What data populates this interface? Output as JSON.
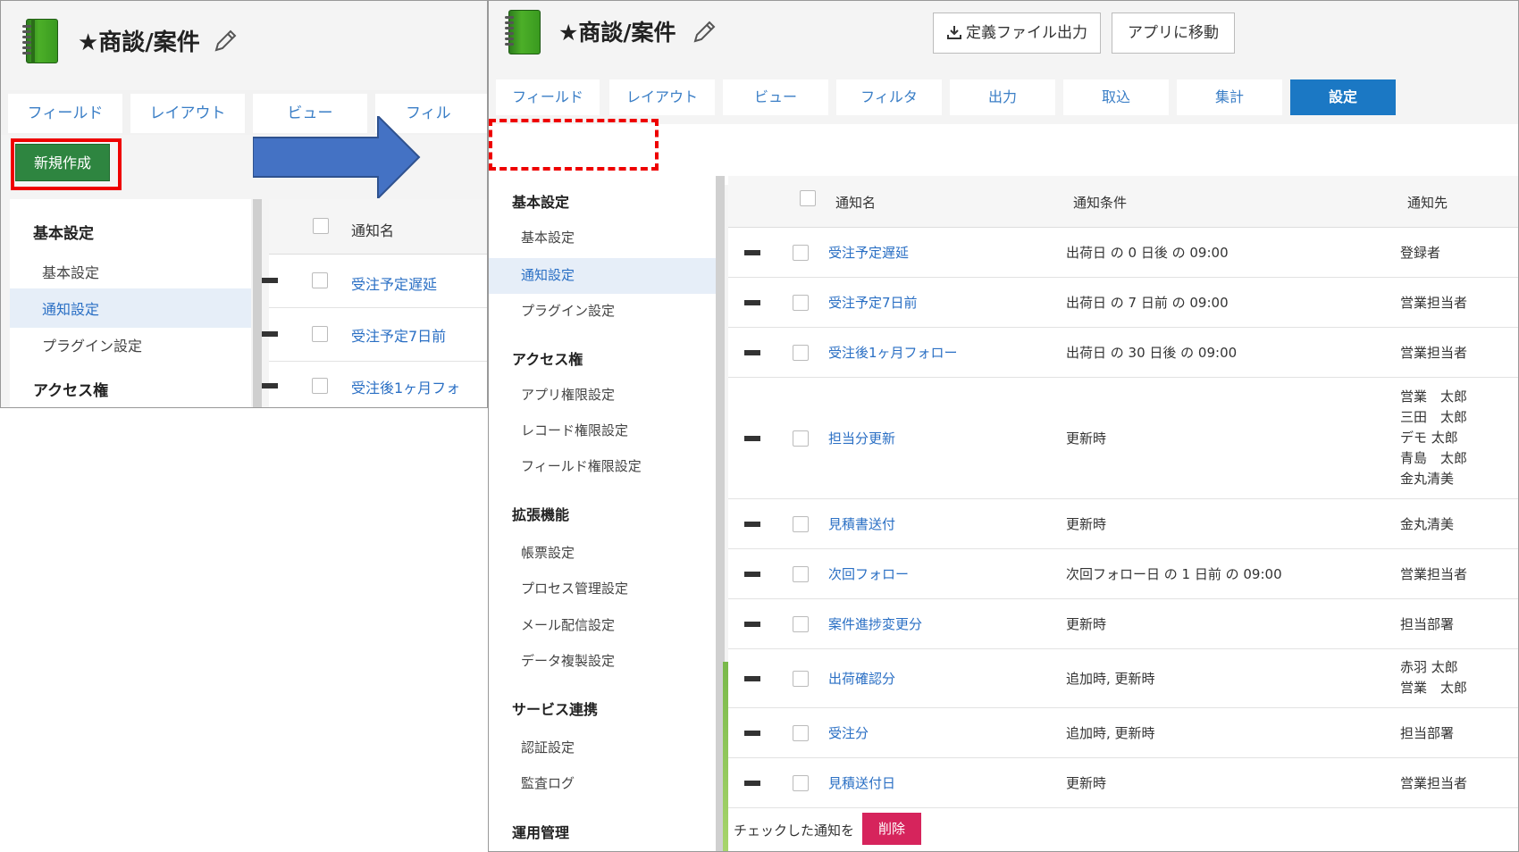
{
  "app": {
    "title": "★商談/案件"
  },
  "left_panel": {
    "tabs": [
      "フィールド",
      "レイアウト",
      "ビュー",
      "フィル"
    ],
    "new_button": "新規作成",
    "menu": {
      "section_basic": "基本設定",
      "items": [
        "基本設定",
        "通知設定",
        "プラグイン設定"
      ],
      "section_access": "アクセス権"
    },
    "table": {
      "header_name": "通知名",
      "rows": [
        "受注予定遅延",
        "受注予定7日前",
        "受注後1ヶ月フォ"
      ]
    }
  },
  "right_panel": {
    "buttons": {
      "export": "定義ファイル出力",
      "goto_app": "アプリに移動"
    },
    "tabs": [
      "フィールド",
      "レイアウト",
      "ビュー",
      "フィルタ",
      "出力",
      "取込",
      "集計",
      "設定"
    ],
    "active_tab": "設定",
    "menu": [
      {
        "heading": "基本設定",
        "items": [
          "基本設定",
          "通知設定",
          "プラグイン設定"
        ]
      },
      {
        "heading": "アクセス権",
        "items": [
          "アプリ権限設定",
          "レコード権限設定",
          "フィールド権限設定"
        ]
      },
      {
        "heading": "拡張機能",
        "items": [
          "帳票設定",
          "プロセス管理設定",
          "メール配信設定",
          "データ複製設定"
        ]
      },
      {
        "heading": "サービス連携",
        "items": [
          "認証設定",
          "監査ログ"
        ]
      },
      {
        "heading": "運用管理",
        "items": []
      }
    ],
    "selected_menu_item": "通知設定",
    "table": {
      "headers": [
        "通知名",
        "通知条件",
        "通知先"
      ],
      "rows": [
        {
          "name": "受注予定遅延",
          "condition": "出荷日 の 0 日後 の 09:00",
          "recipients": [
            "登録者"
          ]
        },
        {
          "name": "受注予定7日前",
          "condition": "出荷日 の 7 日前 の 09:00",
          "recipients": [
            "営業担当者"
          ]
        },
        {
          "name": "受注後1ヶ月フォロー",
          "condition": "出荷日 の 30 日後 の 09:00",
          "recipients": [
            "営業担当者"
          ]
        },
        {
          "name": "担当分更新",
          "condition": "更新時",
          "recipients": [
            "営業　太郎",
            "三田　太郎",
            "デモ 太郎",
            "青島　太郎",
            "金丸清美"
          ]
        },
        {
          "name": "見積書送付",
          "condition": "更新時",
          "recipients": [
            "金丸清美"
          ]
        },
        {
          "name": "次回フォロー",
          "condition": "次回フォロー日 の 1 日前 の 09:00",
          "recipients": [
            "営業担当者"
          ]
        },
        {
          "name": "案件進捗変更分",
          "condition": "更新時",
          "recipients": [
            "担当部署"
          ]
        },
        {
          "name": "出荷確認分",
          "condition": "追加時, 更新時",
          "recipients": [
            "赤羽 太郎",
            "営業　太郎"
          ]
        },
        {
          "name": "受注分",
          "condition": "追加時, 更新時",
          "recipients": [
            "担当部署"
          ]
        },
        {
          "name": "見積送付日",
          "condition": "更新時",
          "recipients": [
            "営業担当者"
          ]
        }
      ]
    },
    "footer": {
      "text": "チェックした通知を",
      "delete_button": "削除"
    }
  },
  "colors": {
    "accent": "#1b78c4",
    "new_button": "#2e8540",
    "delete_button": "#d6245c",
    "highlight": "#ee0000",
    "link": "#2a6fc4"
  }
}
